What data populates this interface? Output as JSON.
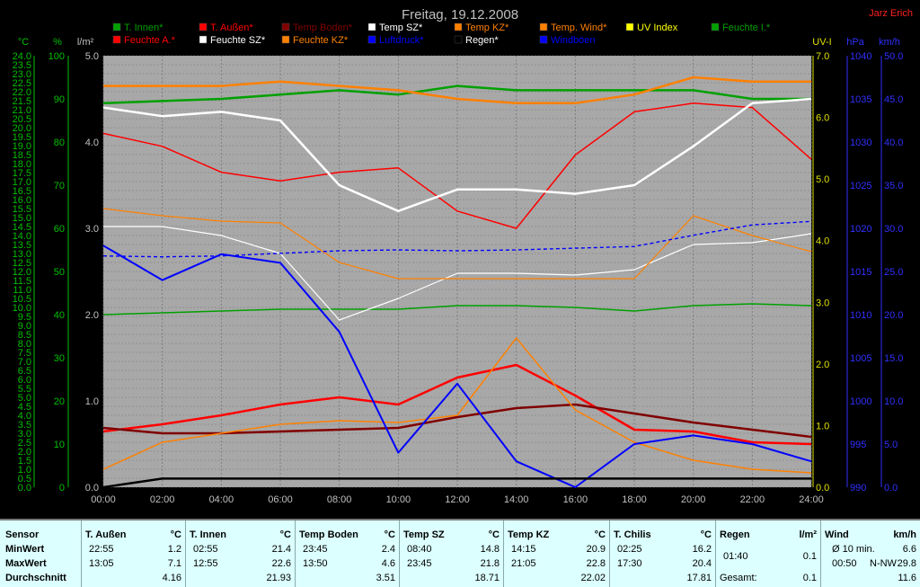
{
  "title": "Freitag, 19.12.2008",
  "author": "Jarz Erich",
  "legend": [
    {
      "label": "T. Innen*",
      "color": "#00a000"
    },
    {
      "label": "T. Außen*",
      "color": "#ff0000"
    },
    {
      "label": "Temp Boden*",
      "color": "#800000"
    },
    {
      "label": "Temp SZ*",
      "color": "#ffffff"
    },
    {
      "label": "Temp KZ*",
      "color": "#ff8000"
    },
    {
      "label": "Temp. Wind*",
      "color": "#ff8000"
    },
    {
      "label": "UV Index",
      "color": "#ffff00"
    },
    {
      "label": "Feuchte I.*",
      "color": "#00a000"
    },
    {
      "label": "Feuchte A.*",
      "color": "#ff0000"
    },
    {
      "label": "Feuchte SZ*",
      "color": "#ffffff"
    },
    {
      "label": "Feuchte KZ*",
      "color": "#ff8000"
    },
    {
      "label": "Luftdruck*",
      "color": "#0000ff"
    },
    {
      "label": "Regen*",
      "color": "#000000"
    },
    {
      "label": "Windböen",
      "color": "#0000ff"
    }
  ],
  "axis_units": {
    "temp": "°C",
    "humidity": "%",
    "rain": "l/m²",
    "uv": "UV-I",
    "pressure": "hPa",
    "wind": "km/h"
  },
  "chart_data": {
    "type": "line",
    "x": [
      "00:00",
      "02:00",
      "04:00",
      "06:00",
      "08:00",
      "10:00",
      "12:00",
      "14:00",
      "16:00",
      "18:00",
      "20:00",
      "22:00",
      "24:00"
    ],
    "axes": {
      "temp": {
        "ticks": [
          "0.0",
          "0.5",
          "1.0",
          "1.5",
          "2.0",
          "2.5",
          "3.0",
          "3.5",
          "4.0",
          "4.5",
          "5.0",
          "5.5",
          "6.0",
          "6.5",
          "7.0",
          "7.5",
          "8.0",
          "8.5",
          "9.0",
          "9.5",
          "10.0",
          "10.5",
          "11.0",
          "11.5",
          "12.0",
          "12.5",
          "13.0",
          "13.5",
          "14.0",
          "14.5",
          "15.0",
          "15.5",
          "16.0",
          "16.5",
          "17.0",
          "17.5",
          "18.0",
          "18.5",
          "19.0",
          "19.5",
          "20.0",
          "20.5",
          "21.0",
          "21.5",
          "22.0",
          "22.5",
          "23.0",
          "23.5",
          "24.0"
        ],
        "ylim": [
          0,
          24
        ]
      },
      "humidity": {
        "ticks": [
          "0",
          "10",
          "20",
          "30",
          "40",
          "50",
          "60",
          "70",
          "80",
          "90",
          "100"
        ],
        "ylim": [
          0,
          100
        ]
      },
      "rain": {
        "ticks": [
          "0.0",
          "1.0",
          "2.0",
          "3.0",
          "4.0",
          "5.0"
        ],
        "ylim": [
          0,
          5
        ]
      },
      "uv": {
        "ticks": [
          "0.0",
          "1.0",
          "2.0",
          "3.0",
          "4.0",
          "5.0",
          "6.0",
          "7.0"
        ],
        "ylim": [
          0,
          7
        ]
      },
      "pressure": {
        "ticks": [
          "990",
          "995",
          "1000",
          "1005",
          "1010",
          "1015",
          "1020",
          "1025",
          "1030",
          "1035",
          "1040"
        ],
        "ylim": [
          990,
          1040
        ]
      },
      "wind": {
        "ticks": [
          "0.0",
          "5.0",
          "10.0",
          "15.0",
          "20.0",
          "25.0",
          "30.0",
          "35.0",
          "40.0",
          "45.0",
          "50.0"
        ],
        "ylim": [
          0,
          50
        ]
      }
    },
    "series": [
      {
        "name": "T. Innen",
        "axis": "temp",
        "color": "#00a000",
        "values": [
          9.6,
          9.7,
          9.8,
          9.9,
          9.9,
          9.9,
          10.1,
          10.1,
          10.0,
          9.8,
          10.1,
          10.2,
          10.1
        ]
      },
      {
        "name": "Feuchte I.",
        "axis": "humidity",
        "color": "#00a000",
        "values": [
          89,
          89.5,
          90,
          91,
          92,
          91,
          93,
          92,
          92,
          92,
          92,
          90,
          90
        ]
      },
      {
        "name": "T. Außen",
        "axis": "temp",
        "color": "#ff0000",
        "values": [
          3.1,
          3.5,
          4.0,
          4.6,
          5.0,
          4.6,
          6.1,
          6.8,
          5.1,
          3.2,
          3.1,
          2.5,
          2.4
        ]
      },
      {
        "name": "Feuchte A.",
        "axis": "humidity",
        "color": "#ff0000",
        "values": [
          82,
          79,
          73,
          71,
          73,
          74,
          64,
          60,
          77,
          87,
          89,
          88,
          76
        ]
      },
      {
        "name": "Temp Boden",
        "axis": "temp",
        "color": "#800000",
        "values": [
          3.3,
          3.0,
          3.0,
          3.1,
          3.2,
          3.3,
          3.9,
          4.4,
          4.6,
          4.1,
          3.6,
          3.2,
          2.8
        ]
      },
      {
        "name": "Temp SZ",
        "axis": "temp",
        "color": "#ffffff",
        "values": [
          14.5,
          14.5,
          14.0,
          13.0,
          9.3,
          10.5,
          11.9,
          11.9,
          11.8,
          12.1,
          13.5,
          13.6,
          14.1
        ]
      },
      {
        "name": "Feuchte SZ",
        "axis": "humidity",
        "color": "#ffffff",
        "values": [
          88,
          86,
          87,
          85,
          70,
          64,
          69,
          69,
          68,
          70,
          79,
          89,
          90
        ]
      },
      {
        "name": "Temp KZ",
        "axis": "temp",
        "color": "#ff8000",
        "values": [
          15.5,
          15.1,
          14.8,
          14.7,
          12.5,
          11.6,
          11.6,
          11.6,
          11.6,
          11.6,
          15.1,
          14.0,
          13.1
        ]
      },
      {
        "name": "Feuchte KZ",
        "axis": "humidity",
        "color": "#ff8000",
        "values": [
          93,
          93,
          93,
          94,
          93,
          92,
          90,
          89,
          89,
          91,
          95,
          94,
          94
        ]
      },
      {
        "name": "Temp. Wind",
        "axis": "temp",
        "color": "#ff8000",
        "values": [
          1.0,
          2.5,
          3.0,
          3.5,
          3.7,
          3.6,
          4.0,
          8.3,
          4.3,
          2.5,
          1.5,
          1.0,
          0.8
        ]
      },
      {
        "name": "Luftdruck",
        "axis": "pressure",
        "color": "#0000ff",
        "values": [
          1016.8,
          1016.7,
          1016.8,
          1017.1,
          1017.4,
          1017.5,
          1017.4,
          1017.5,
          1017.7,
          1017.9,
          1019.2,
          1020.4,
          1020.8
        ]
      },
      {
        "name": "Windböen",
        "axis": "wind",
        "color": "#0000ff",
        "values": [
          28,
          24,
          27,
          26,
          18,
          4,
          12,
          3,
          0,
          5,
          6,
          5,
          3
        ]
      },
      {
        "name": "Regen",
        "axis": "rain",
        "color": "#000000",
        "values": [
          0.0,
          0.1,
          0.1,
          0.1,
          0.1,
          0.1,
          0.1,
          0.1,
          0.1,
          0.1,
          0.1,
          0.1,
          0.1
        ]
      }
    ]
  },
  "stats": {
    "row_labels": [
      "Sensor",
      "MinWert",
      "MaxWert",
      "Durchschnitt"
    ],
    "columns": [
      {
        "name": "T. Außen",
        "unit": "°C",
        "min_time": "22:55",
        "min": "1.2",
        "max_time": "13:05",
        "max": "7.1",
        "avg": "4.16"
      },
      {
        "name": "T. Innen",
        "unit": "°C",
        "min_time": "02:55",
        "min": "21.4",
        "max_time": "12:55",
        "max": "22.6",
        "avg": "21.93"
      },
      {
        "name": "Temp Boden",
        "unit": "°C",
        "min_time": "23:45",
        "min": "2.4",
        "max_time": "13:50",
        "max": "4.6",
        "avg": "3.51"
      },
      {
        "name": "Temp SZ",
        "unit": "°C",
        "min_time": "08:40",
        "min": "14.8",
        "max_time": "23:45",
        "max": "21.8",
        "avg": "18.71"
      },
      {
        "name": "Temp KZ",
        "unit": "°C",
        "min_time": "14:15",
        "min": "20.9",
        "max_time": "21:05",
        "max": "22.8",
        "avg": "22.02"
      },
      {
        "name": "T. Chilis",
        "unit": "°C",
        "min_time": "02:25",
        "min": "16.2",
        "max_time": "17:30",
        "max": "20.4",
        "avg": "17.81"
      }
    ],
    "rain": {
      "name": "Regen",
      "unit": "l/m²",
      "t1": "01:40",
      "v1": "0.1",
      "label3": "Gesamt:",
      "v3": "0.1"
    },
    "wind": {
      "name": "Wind",
      "unit": "km/h",
      "label1": "Ø 10 min.",
      "v1": "6.6",
      "t2": "00:50",
      "dir2": "N-NW",
      "v2": "29.8",
      "v3": "11.6"
    }
  }
}
